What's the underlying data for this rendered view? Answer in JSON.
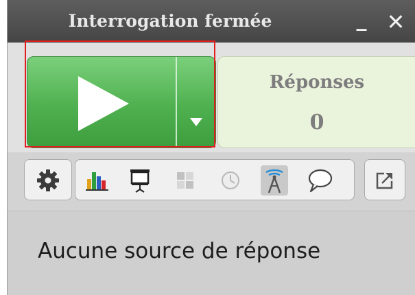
{
  "window": {
    "title": "Interrogation fermée",
    "minimize_label": "_",
    "close_label": "✕"
  },
  "responses": {
    "label": "Réponses",
    "count": "0"
  },
  "status": {
    "message": "Aucune source de réponse"
  },
  "colors": {
    "titlebar": "#4f4f4f",
    "start_button": "#5cbd5c",
    "selection_outline": "#e21d1d",
    "responses_panel": "#eaf3dc"
  },
  "icons": {
    "start": "play-icon",
    "start_menu": "caret-down-icon",
    "settings": "gear-icon",
    "chart": "bar-chart-icon",
    "projector": "projector-screen-icon",
    "grid": "grid-icon",
    "clock": "clock-icon",
    "antenna": "antenna-icon",
    "comment": "speech-bubble-icon",
    "export": "export-icon"
  }
}
